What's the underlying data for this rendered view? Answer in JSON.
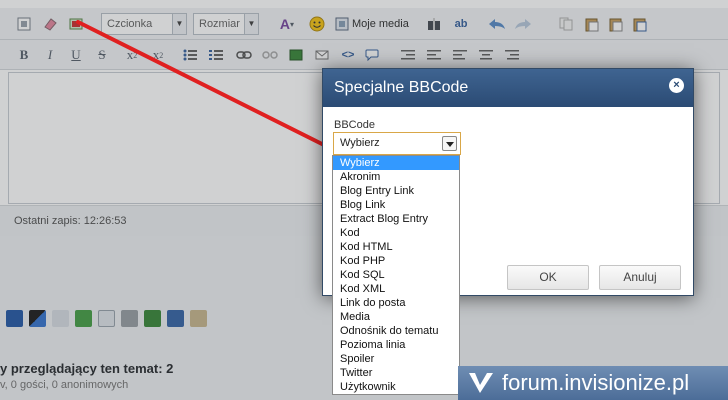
{
  "editor": {
    "font_select": "Czcionka",
    "size_select": "Rozmiar",
    "media_label": "Moje media",
    "last_saved": "Ostatni zapis: 12:26:53"
  },
  "topic": {
    "viewers_title": "y przeglądający ten temat: 2",
    "viewers_sub": "v, 0 gości, 0 anonimowych"
  },
  "dialog": {
    "title": "Specjalne BBCode",
    "field_label": "BBCode",
    "selected": "Wybierz",
    "options": [
      "Wybierz",
      "Akronim",
      "Blog Entry Link",
      "Blog Link",
      "Extract Blog Entry",
      "Kod",
      "Kod HTML",
      "Kod PHP",
      "Kod SQL",
      "Kod XML",
      "Link do posta",
      "Media",
      "Odnośnik do tematu",
      "Pozioma linia",
      "Spoiler",
      "Twitter",
      "Użytkownik"
    ],
    "ok_label": "OK",
    "cancel_label": "Anuluj"
  },
  "watermark": {
    "text": "forum.invisionize.pl"
  },
  "colors": {
    "dialog_header": "#2f5180",
    "highlight": "#3399ff",
    "arrow": "#e02020",
    "watermark_bg": "#5a7aa5"
  }
}
